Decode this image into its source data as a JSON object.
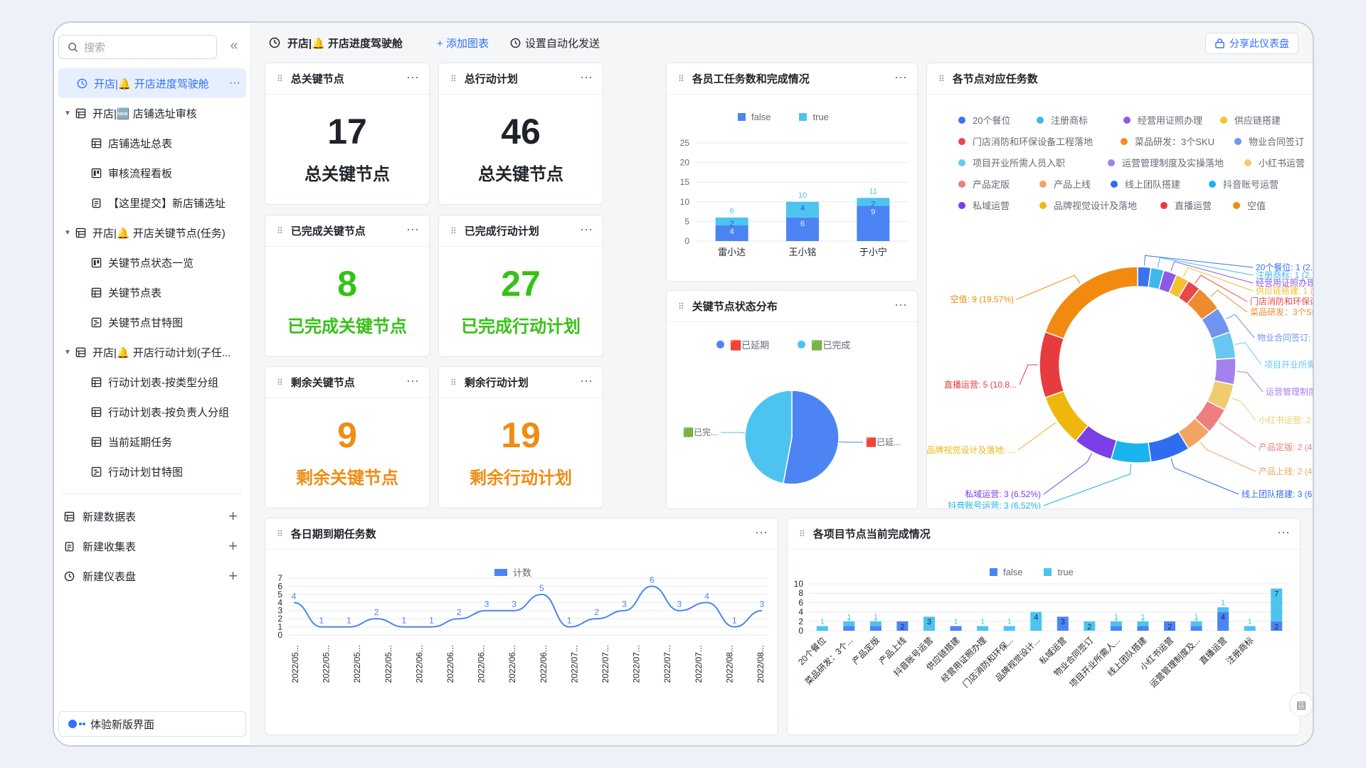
{
  "sidebar": {
    "search_placeholder": "搜索",
    "items": [
      {
        "label": "开店|🔔 开店进度驾驶舱",
        "icon": "dashboard-icon",
        "level": 1,
        "active": true
      },
      {
        "label": "开店|🆕 店铺选址审核",
        "icon": "table-icon",
        "level": 0,
        "expanded": true
      },
      {
        "label": "店铺选址总表",
        "icon": "grid-view-icon",
        "level": 1
      },
      {
        "label": "审核流程看板",
        "icon": "kanban-icon",
        "level": 1
      },
      {
        "label": "【这里提交】新店铺选址",
        "icon": "form-icon",
        "level": 1
      },
      {
        "label": "开店|🔔 开店关键节点(任务)",
        "icon": "table-icon",
        "level": 0,
        "expanded": true
      },
      {
        "label": "关键节点状态一览",
        "icon": "kanban-icon",
        "level": 1
      },
      {
        "label": "关键节点表",
        "icon": "grid-view-icon",
        "level": 1
      },
      {
        "label": "关键节点甘特图",
        "icon": "gantt-icon",
        "level": 1
      },
      {
        "label": "开店|🔔 开店行动计划(子任...",
        "icon": "table-icon",
        "level": 0,
        "expanded": true
      },
      {
        "label": "行动计划表-按类型分组",
        "icon": "grid-view-icon",
        "level": 1
      },
      {
        "label": "行动计划表-按负责人分组",
        "icon": "grid-view-icon",
        "level": 1
      },
      {
        "label": "当前延期任务",
        "icon": "grid-view-icon",
        "level": 1
      },
      {
        "label": "行动计划甘特图",
        "icon": "gantt-icon",
        "level": 1
      }
    ],
    "new_items": [
      {
        "label": "新建数据表",
        "icon": "table-icon"
      },
      {
        "label": "新建收集表",
        "icon": "form-icon"
      },
      {
        "label": "新建仪表盘",
        "icon": "dashboard-icon"
      }
    ],
    "new_ui": "体验新版界面"
  },
  "topbar": {
    "title": "开店|🔔 开店进度驾驶舱",
    "add_chart": "+ 添加图表",
    "auto_send": "设置自动化发送",
    "share": "分享此仪表盘"
  },
  "colors": {
    "blue": "#4c84f3",
    "cyan": "#4dc4ef",
    "green": "#35c216",
    "orange": "#f08c12",
    "accent": "#3370ff"
  },
  "kpis": [
    {
      "title": "总关键节点",
      "value": "17",
      "label": "总关键节点",
      "color": "#1f2329"
    },
    {
      "title": "总行动计划",
      "value": "46",
      "label": "总关键节点",
      "color": "#1f2329"
    },
    {
      "title": "已完成关键节点",
      "value": "8",
      "label": "已完成关键节点",
      "color": "#35c216"
    },
    {
      "title": "已完成行动计划",
      "value": "27",
      "label": "已完成行动计划",
      "color": "#35c216"
    },
    {
      "title": "剩余关键节点",
      "value": "9",
      "label": "剩余关键节点",
      "color": "#f08c12"
    },
    {
      "title": "剩余行动计划",
      "value": "19",
      "label": "剩余行动计划",
      "color": "#f08c12"
    }
  ],
  "chart_titles": {
    "staff": "各员工任务数和完成情况",
    "status": "关键节点状态分布",
    "nodes": "各节点对应任务数",
    "daily": "各日期到期任务数",
    "project": "各项目节点当前完成情况"
  },
  "chart_data": [
    {
      "id": "staff",
      "type": "bar",
      "stacked": true,
      "categories": [
        "雷小达",
        "王小铭",
        "于小宁"
      ],
      "series": [
        {
          "name": "false",
          "values": [
            4,
            6,
            9
          ],
          "color": "#4c84f3"
        },
        {
          "name": "true",
          "values": [
            2,
            4,
            2
          ],
          "color": "#4dc4ef"
        }
      ],
      "totals": [
        6,
        10,
        11
      ],
      "ylim": [
        0,
        25
      ],
      "yticks": [
        0,
        5,
        10,
        15,
        20,
        25
      ],
      "legend": "top"
    },
    {
      "id": "status",
      "type": "pie",
      "slices": [
        {
          "name": "🟥已延期",
          "label": "🟥已延...",
          "value": 9,
          "color": "#4c84f3"
        },
        {
          "name": "🟩已完成",
          "label": "🟩已完...",
          "value": 8,
          "color": "#4dc4ef"
        }
      ],
      "legend": "top"
    },
    {
      "id": "nodes",
      "type": "pie",
      "donut": true,
      "slices": [
        {
          "name": "20个餐位",
          "value": 1,
          "pct": "2.17%",
          "label": "20个餐位: 1 (2.17%)",
          "color": "#3a73f0"
        },
        {
          "name": "注册商标",
          "value": 1,
          "pct": "2.17%",
          "label": "注册商标: 1 (2.17%)",
          "color": "#40b7ec"
        },
        {
          "name": "经营用证照办理",
          "value": 1,
          "pct": "2.17%",
          "label": "经营用证照办理: 1 (2.17%)",
          "color": "#8e58e8"
        },
        {
          "name": "供应链搭建",
          "value": 1,
          "pct": "2.17%",
          "label": "供应链搭建: 1 (2.17%)",
          "color": "#f2c230"
        },
        {
          "name": "门店消防和环保设备工程落地",
          "value": 1,
          "pct": "2.17%",
          "label": "门店消防和环保设备工程...",
          "color": "#e8474b"
        },
        {
          "name": "菜品研发：3个SKU",
          "value": 2,
          "pct": "",
          "label": "菜品研发：3个SKU: 2 ...",
          "color": "#f08a2e"
        },
        {
          "name": "物业合同签订",
          "value": 2,
          "pct": "",
          "label": "物业合同签订: 2 (4....",
          "color": "#6f95f0"
        },
        {
          "name": "项目开业所需人员入职",
          "value": 2,
          "pct": "",
          "label": "项目开业所需人员...",
          "color": "#66c8f0"
        },
        {
          "name": "运营管理制度及实操落地",
          "value": 2,
          "pct": "",
          "label": "运营管理制度及...",
          "color": "#a482ee"
        },
        {
          "name": "小红书运营",
          "value": 2,
          "pct": "",
          "label": "小红书运营: 2 (4.3...",
          "color": "#f0cc6e"
        },
        {
          "name": "产品定版",
          "value": 2,
          "pct": "4.35%",
          "label": "产品定版: 2 (4.35%)",
          "color": "#ee7f7f"
        },
        {
          "name": "产品上线",
          "value": 2,
          "pct": "4.35%",
          "label": "产品上线: 2 (4.35%)",
          "color": "#f2a462"
        },
        {
          "name": "线上团队搭建",
          "value": 3,
          "pct": "6.52%",
          "label": "线上团队搭建: 3 (6.52%)",
          "color": "#2f6cf0"
        },
        {
          "name": "抖音账号运营",
          "value": 3,
          "pct": "6.52%",
          "label": "抖音账号运营: 3 (6.52%)",
          "color": "#1ab3ee"
        },
        {
          "name": "私域运营",
          "value": 3,
          "pct": "6.52%",
          "label": "私域运营: 3 (6.52%)",
          "color": "#7a3fe6"
        },
        {
          "name": "品牌视觉设计及落地",
          "value": 4,
          "pct": "",
          "label": "品牌视觉设计及落地: ...",
          "color": "#efb70e"
        },
        {
          "name": "直播运营",
          "value": 5,
          "pct": "",
          "label": "直播运营: 5 (10.8...",
          "color": "#e63c40"
        },
        {
          "name": "空值",
          "value": 9,
          "pct": "19.57%",
          "label": "空值: 9 (19.57%)",
          "color": "#f28a10"
        }
      ],
      "legend": "top"
    },
    {
      "id": "daily",
      "type": "line",
      "series": [
        {
          "name": "计数",
          "color": "#4c84f3"
        }
      ],
      "x": [
        "2022/05...",
        "2022/05...",
        "2022/05...",
        "2022/05...",
        "2022/06...",
        "2022/06...",
        "2022/06...",
        "2022/06...",
        "2022/06...",
        "2022/07...",
        "2022/07...",
        "2022/07...",
        "2022/07...",
        "2022/07...",
        "2022/08...",
        "2022/08..."
      ],
      "values": [
        4,
        1,
        1,
        2,
        1,
        1,
        2,
        3,
        3,
        5,
        1,
        2,
        3,
        6,
        3,
        4,
        1,
        3
      ],
      "ylim": [
        0,
        7
      ],
      "yticks": [
        0,
        1,
        2,
        3,
        4,
        5,
        6,
        7
      ],
      "legend": "top"
    },
    {
      "id": "project",
      "type": "bar",
      "stacked": true,
      "categories": [
        "20个餐位",
        "菜品研发：3个...",
        "产品定版",
        "产品上线",
        "抖音账号运营",
        "供应链搭建",
        "经营用证照办理",
        "门店消防和环保...",
        "品牌视觉设计...",
        "私域运营",
        "物业合同签订",
        "项目开业所需人...",
        "线上团队搭建",
        "小红书运营",
        "运营管理制度及...",
        "直播运营",
        "注册商标",
        ""
      ],
      "series": [
        {
          "name": "false",
          "values": [
            0,
            1,
            1,
            2,
            0,
            1,
            0,
            0,
            0,
            3,
            0,
            1,
            1,
            2,
            1,
            4,
            0,
            2
          ],
          "color": "#4c84f3"
        },
        {
          "name": "true",
          "values": [
            1,
            1,
            1,
            0,
            3,
            0,
            1,
            1,
            4,
            0,
            2,
            1,
            1,
            0,
            1,
            1,
            1,
            7
          ],
          "color": "#4dc4ef"
        }
      ],
      "ylim": [
        0,
        10
      ],
      "yticks": [
        0,
        2,
        4,
        6,
        8,
        10
      ],
      "legend": "top"
    }
  ]
}
